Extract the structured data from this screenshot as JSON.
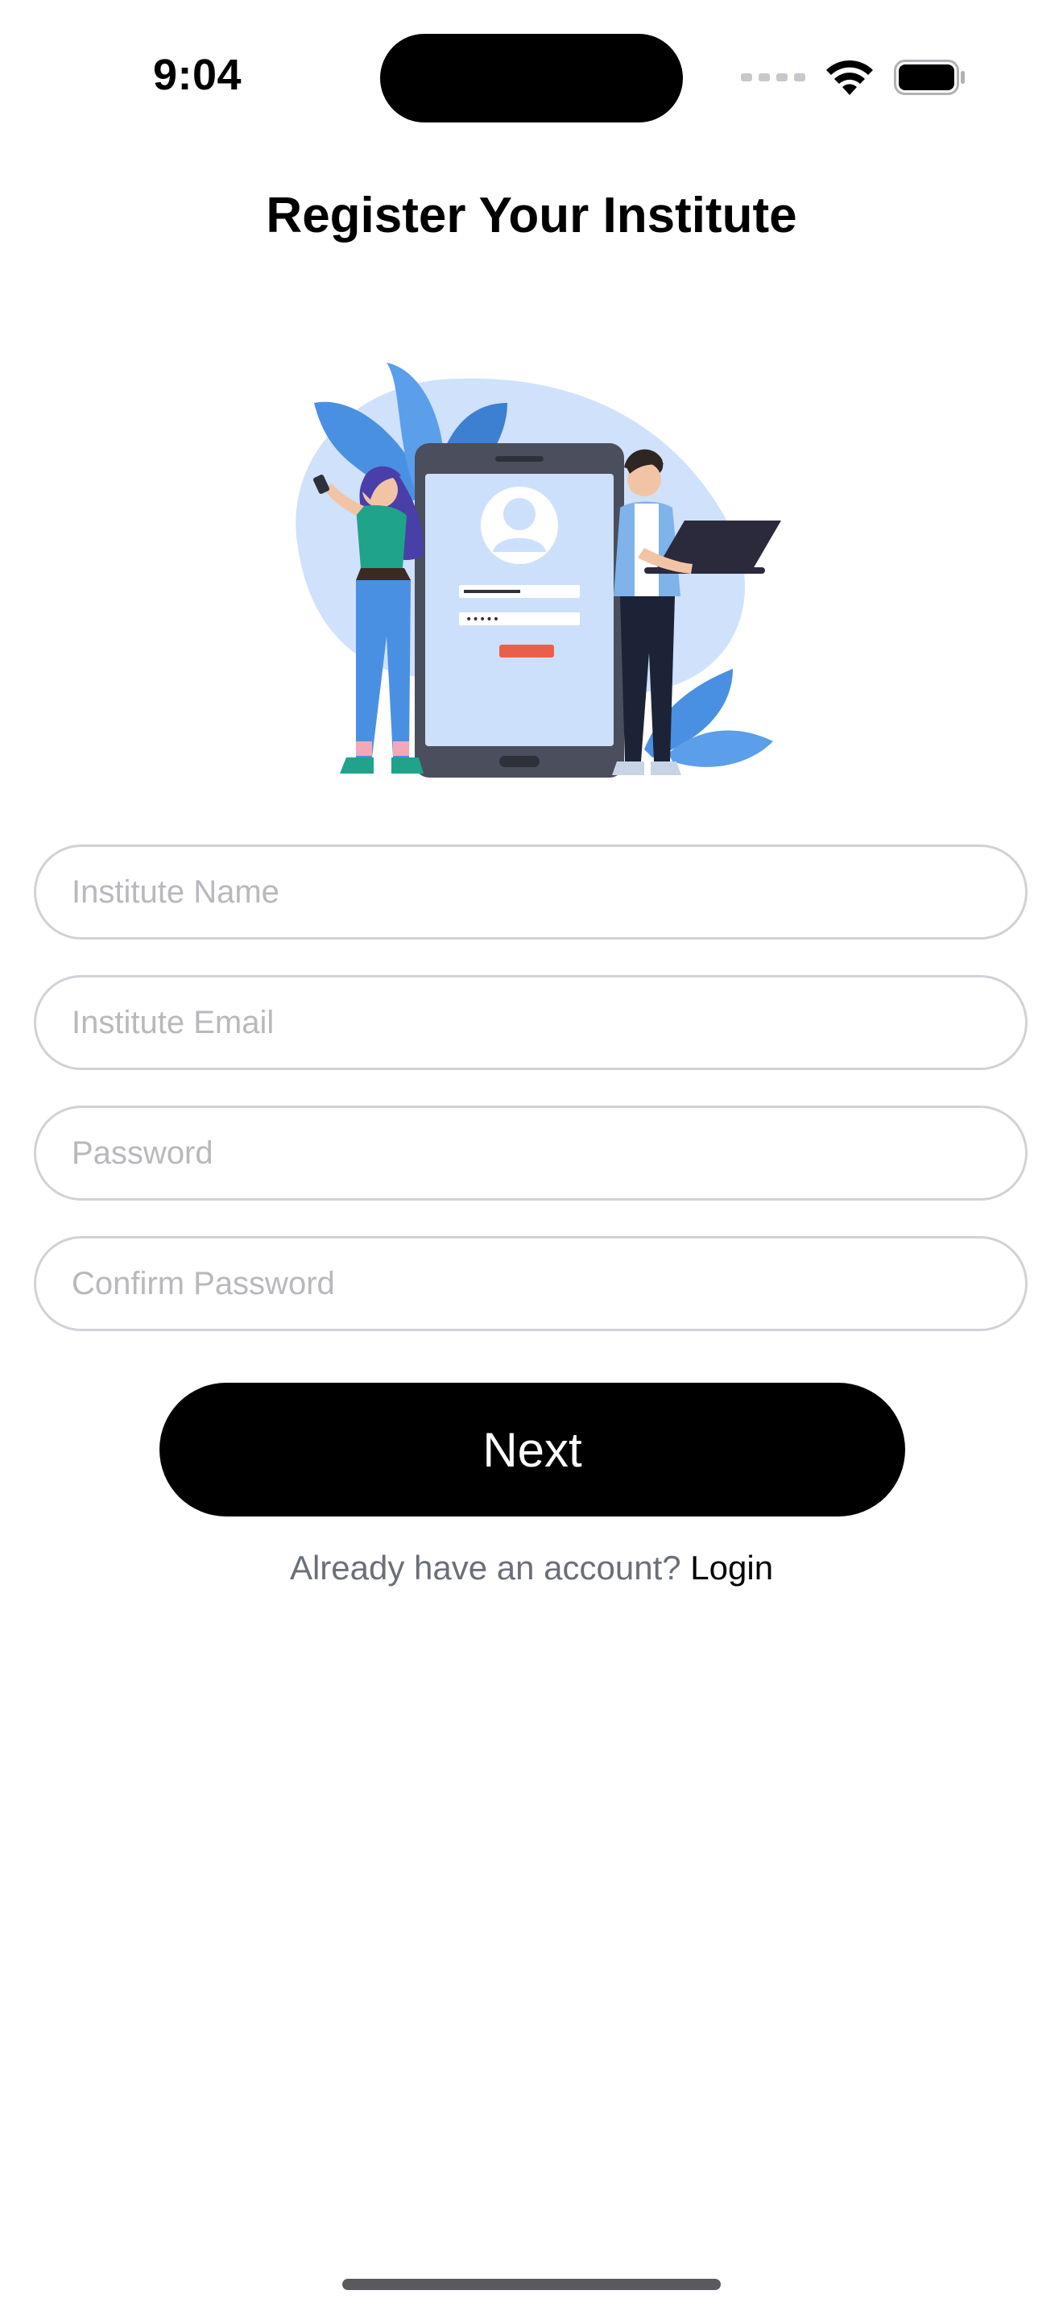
{
  "status_bar": {
    "time": "9:04",
    "icons": [
      "cellular-signal-icon",
      "wifi-icon",
      "battery-icon"
    ]
  },
  "header": {
    "title": "Register Your Institute"
  },
  "illustration": {
    "icon": "registration-illustration",
    "colors": {
      "blob": "#cfe1fb",
      "leaf": "#4a90e2",
      "phone": "#4b4e5c",
      "screen": "#cde0fb",
      "button": "#e8604c"
    }
  },
  "form": {
    "institute_name": {
      "value": "",
      "placeholder": "Institute Name"
    },
    "institute_email": {
      "value": "",
      "placeholder": "Institute Email"
    },
    "password": {
      "value": "",
      "placeholder": "Password"
    },
    "confirm_password": {
      "value": "",
      "placeholder": "Confirm Password"
    },
    "next_label": "Next"
  },
  "footer": {
    "prompt": "Already have an account?",
    "login_label": "Login"
  },
  "colors": {
    "primary_button": "#000000",
    "field_border": "#d1d1d6",
    "placeholder": "#b8b8bd",
    "muted_text": "#6b6f78"
  }
}
